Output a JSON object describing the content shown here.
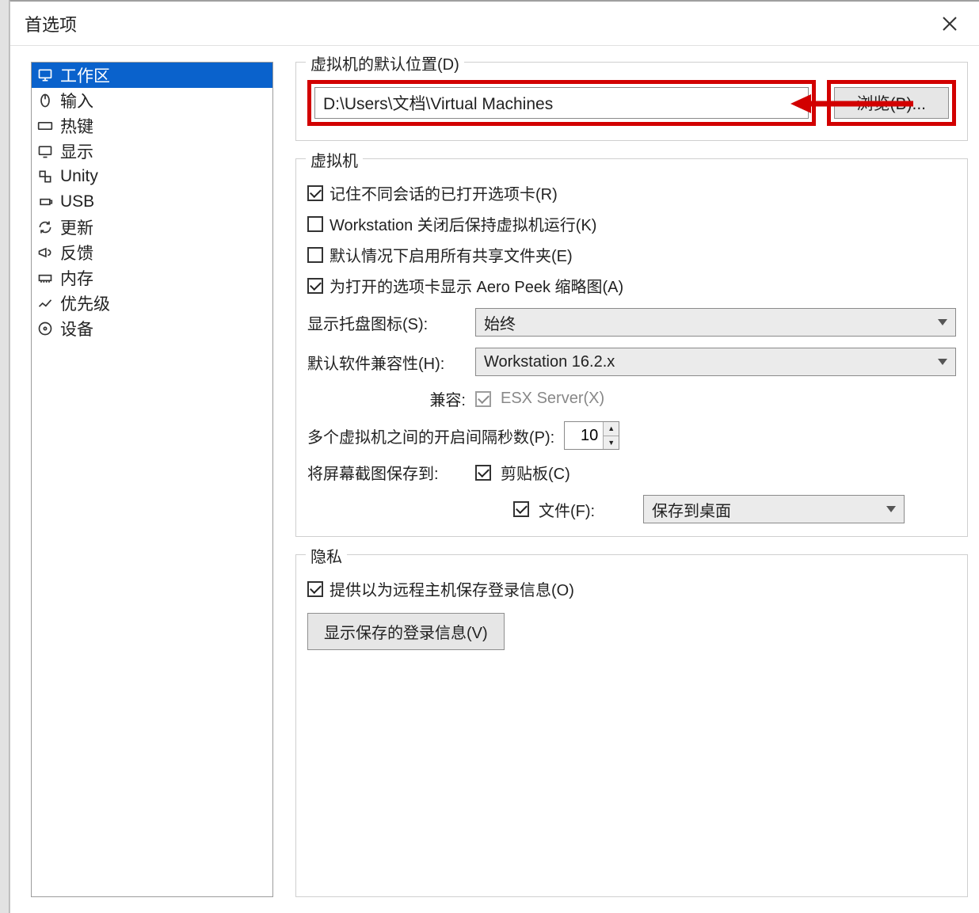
{
  "window": {
    "title": "首选项"
  },
  "sidebar": {
    "items": [
      {
        "label": "工作区",
        "icon": "monitor-icon",
        "selected": true
      },
      {
        "label": "输入",
        "icon": "mouse-icon"
      },
      {
        "label": "热键",
        "icon": "keyboard-icon"
      },
      {
        "label": "显示",
        "icon": "display-icon"
      },
      {
        "label": "Unity",
        "icon": "unity-icon"
      },
      {
        "label": "USB",
        "icon": "usb-icon"
      },
      {
        "label": "更新",
        "icon": "refresh-icon"
      },
      {
        "label": "反馈",
        "icon": "megaphone-icon"
      },
      {
        "label": "内存",
        "icon": "memory-icon"
      },
      {
        "label": "优先级",
        "icon": "priority-icon"
      },
      {
        "label": "设备",
        "icon": "disc-icon"
      }
    ]
  },
  "groups": {
    "default_location": {
      "legend": "虚拟机的默认位置(D)",
      "path": "D:\\Users\\文档\\Virtual Machines",
      "browse": "浏览(B)..."
    },
    "vm": {
      "legend": "虚拟机",
      "remember_tabs": "记住不同会话的已打开选项卡(R)",
      "keep_running": "Workstation 关闭后保持虚拟机运行(K)",
      "enable_shared": "默认情况下启用所有共享文件夹(E)",
      "aero_peek": "为打开的选项卡显示 Aero Peek 缩略图(A)",
      "tray_label": "显示托盘图标(S):",
      "tray_value": "始终",
      "compat_label": "默认软件兼容性(H):",
      "compat_value": "Workstation 16.2.x",
      "esx_label": "兼容:",
      "esx_value": "ESX Server(X)",
      "delay_label": "多个虚拟机之间的开启间隔秒数(P):",
      "delay_value": "10",
      "screenshot_label": "将屏幕截图保存到:",
      "clipboard": "剪贴板(C)",
      "file": "文件(F):",
      "save_to_value": "保存到桌面"
    },
    "privacy": {
      "legend": "隐私",
      "offer_save": "提供以为远程主机保存登录信息(O)",
      "show_saved": "显示保存的登录信息(V)"
    }
  }
}
